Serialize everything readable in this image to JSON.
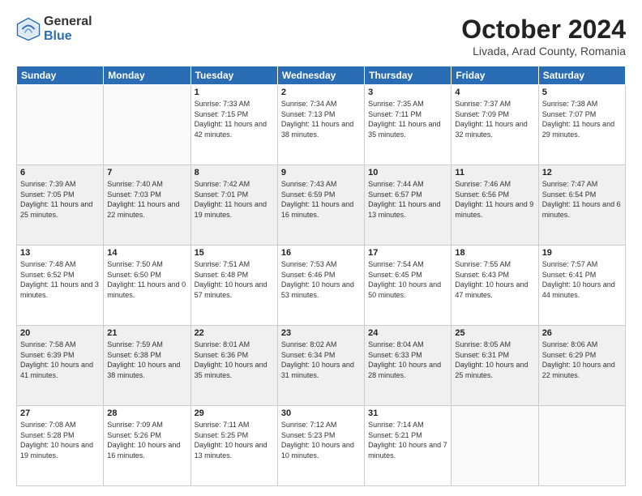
{
  "logo": {
    "general": "General",
    "blue": "Blue"
  },
  "title": "October 2024",
  "location": "Livada, Arad County, Romania",
  "header_days": [
    "Sunday",
    "Monday",
    "Tuesday",
    "Wednesday",
    "Thursday",
    "Friday",
    "Saturday"
  ],
  "weeks": [
    [
      {
        "day": "",
        "info": ""
      },
      {
        "day": "",
        "info": ""
      },
      {
        "day": "1",
        "info": "Sunrise: 7:33 AM\nSunset: 7:15 PM\nDaylight: 11 hours and 42 minutes."
      },
      {
        "day": "2",
        "info": "Sunrise: 7:34 AM\nSunset: 7:13 PM\nDaylight: 11 hours and 38 minutes."
      },
      {
        "day": "3",
        "info": "Sunrise: 7:35 AM\nSunset: 7:11 PM\nDaylight: 11 hours and 35 minutes."
      },
      {
        "day": "4",
        "info": "Sunrise: 7:37 AM\nSunset: 7:09 PM\nDaylight: 11 hours and 32 minutes."
      },
      {
        "day": "5",
        "info": "Sunrise: 7:38 AM\nSunset: 7:07 PM\nDaylight: 11 hours and 29 minutes."
      }
    ],
    [
      {
        "day": "6",
        "info": "Sunrise: 7:39 AM\nSunset: 7:05 PM\nDaylight: 11 hours and 25 minutes."
      },
      {
        "day": "7",
        "info": "Sunrise: 7:40 AM\nSunset: 7:03 PM\nDaylight: 11 hours and 22 minutes."
      },
      {
        "day": "8",
        "info": "Sunrise: 7:42 AM\nSunset: 7:01 PM\nDaylight: 11 hours and 19 minutes."
      },
      {
        "day": "9",
        "info": "Sunrise: 7:43 AM\nSunset: 6:59 PM\nDaylight: 11 hours and 16 minutes."
      },
      {
        "day": "10",
        "info": "Sunrise: 7:44 AM\nSunset: 6:57 PM\nDaylight: 11 hours and 13 minutes."
      },
      {
        "day": "11",
        "info": "Sunrise: 7:46 AM\nSunset: 6:56 PM\nDaylight: 11 hours and 9 minutes."
      },
      {
        "day": "12",
        "info": "Sunrise: 7:47 AM\nSunset: 6:54 PM\nDaylight: 11 hours and 6 minutes."
      }
    ],
    [
      {
        "day": "13",
        "info": "Sunrise: 7:48 AM\nSunset: 6:52 PM\nDaylight: 11 hours and 3 minutes."
      },
      {
        "day": "14",
        "info": "Sunrise: 7:50 AM\nSunset: 6:50 PM\nDaylight: 11 hours and 0 minutes."
      },
      {
        "day": "15",
        "info": "Sunrise: 7:51 AM\nSunset: 6:48 PM\nDaylight: 10 hours and 57 minutes."
      },
      {
        "day": "16",
        "info": "Sunrise: 7:53 AM\nSunset: 6:46 PM\nDaylight: 10 hours and 53 minutes."
      },
      {
        "day": "17",
        "info": "Sunrise: 7:54 AM\nSunset: 6:45 PM\nDaylight: 10 hours and 50 minutes."
      },
      {
        "day": "18",
        "info": "Sunrise: 7:55 AM\nSunset: 6:43 PM\nDaylight: 10 hours and 47 minutes."
      },
      {
        "day": "19",
        "info": "Sunrise: 7:57 AM\nSunset: 6:41 PM\nDaylight: 10 hours and 44 minutes."
      }
    ],
    [
      {
        "day": "20",
        "info": "Sunrise: 7:58 AM\nSunset: 6:39 PM\nDaylight: 10 hours and 41 minutes."
      },
      {
        "day": "21",
        "info": "Sunrise: 7:59 AM\nSunset: 6:38 PM\nDaylight: 10 hours and 38 minutes."
      },
      {
        "day": "22",
        "info": "Sunrise: 8:01 AM\nSunset: 6:36 PM\nDaylight: 10 hours and 35 minutes."
      },
      {
        "day": "23",
        "info": "Sunrise: 8:02 AM\nSunset: 6:34 PM\nDaylight: 10 hours and 31 minutes."
      },
      {
        "day": "24",
        "info": "Sunrise: 8:04 AM\nSunset: 6:33 PM\nDaylight: 10 hours and 28 minutes."
      },
      {
        "day": "25",
        "info": "Sunrise: 8:05 AM\nSunset: 6:31 PM\nDaylight: 10 hours and 25 minutes."
      },
      {
        "day": "26",
        "info": "Sunrise: 8:06 AM\nSunset: 6:29 PM\nDaylight: 10 hours and 22 minutes."
      }
    ],
    [
      {
        "day": "27",
        "info": "Sunrise: 7:08 AM\nSunset: 5:28 PM\nDaylight: 10 hours and 19 minutes."
      },
      {
        "day": "28",
        "info": "Sunrise: 7:09 AM\nSunset: 5:26 PM\nDaylight: 10 hours and 16 minutes."
      },
      {
        "day": "29",
        "info": "Sunrise: 7:11 AM\nSunset: 5:25 PM\nDaylight: 10 hours and 13 minutes."
      },
      {
        "day": "30",
        "info": "Sunrise: 7:12 AM\nSunset: 5:23 PM\nDaylight: 10 hours and 10 minutes."
      },
      {
        "day": "31",
        "info": "Sunrise: 7:14 AM\nSunset: 5:21 PM\nDaylight: 10 hours and 7 minutes."
      },
      {
        "day": "",
        "info": ""
      },
      {
        "day": "",
        "info": ""
      }
    ]
  ]
}
